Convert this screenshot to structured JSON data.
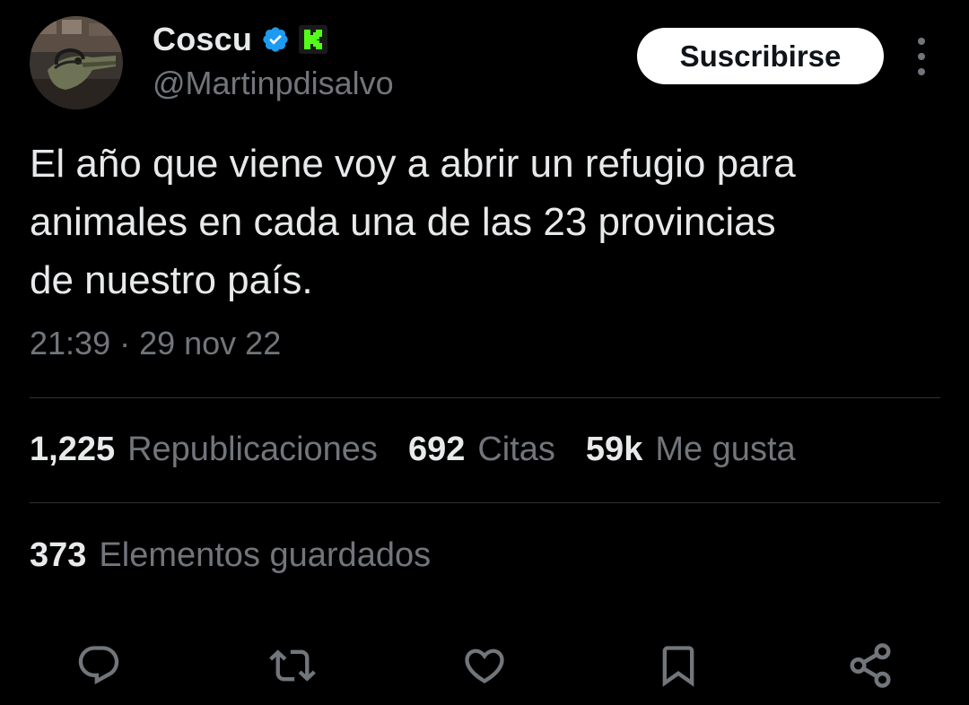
{
  "author": {
    "display_name": "Coscu",
    "handle": "@Martinpdisalvo",
    "avatar_icon": "crocodile-avatar",
    "verified_icon": "verified-badge-icon",
    "affiliate_icon": "kick-logo-icon"
  },
  "header": {
    "subscribe_label": "Suscribirse",
    "more_icon": "more-options-icon"
  },
  "tweet": {
    "text": "El año que viene voy a abrir un refugio para\nanimales en cada una de las 23 provincias\nde nuestro país.",
    "timestamp": "21:39 · 29 nov 22"
  },
  "stats": {
    "reposts_count": "1,225",
    "reposts_label": "Republicaciones",
    "quotes_count": "692",
    "quotes_label": "Citas",
    "likes_count": "59k",
    "likes_label": "Me gusta",
    "bookmarks_count": "373",
    "bookmarks_label": "Elementos guardados"
  },
  "actions": [
    "reply-icon",
    "repost-icon",
    "like-icon",
    "bookmark-icon",
    "share-icon"
  ],
  "colors": {
    "background": "#000000",
    "text_primary": "#e7e9ea",
    "text_secondary": "#71767b",
    "divider": "#2f3336",
    "verified_blue": "#1d9bf0",
    "kick_green": "#53fc18",
    "subscribe_bg": "#ffffff"
  }
}
